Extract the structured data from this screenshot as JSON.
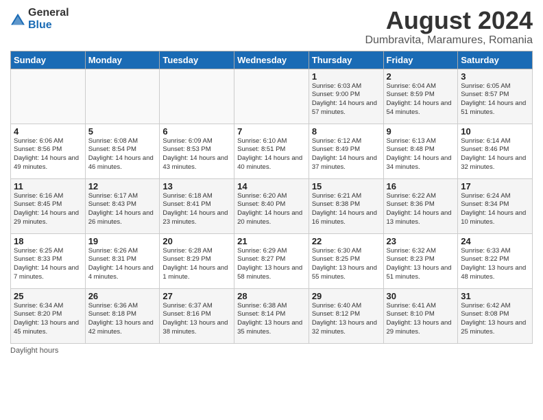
{
  "logo": {
    "general": "General",
    "blue": "Blue"
  },
  "title": "August 2024",
  "subtitle": "Dumbravita, Maramures, Romania",
  "weekdays": [
    "Sunday",
    "Monday",
    "Tuesday",
    "Wednesday",
    "Thursday",
    "Friday",
    "Saturday"
  ],
  "footer": "Daylight hours",
  "weeks": [
    [
      {
        "day": "",
        "info": ""
      },
      {
        "day": "",
        "info": ""
      },
      {
        "day": "",
        "info": ""
      },
      {
        "day": "",
        "info": ""
      },
      {
        "day": "1",
        "info": "Sunrise: 6:03 AM\nSunset: 9:00 PM\nDaylight: 14 hours and 57 minutes."
      },
      {
        "day": "2",
        "info": "Sunrise: 6:04 AM\nSunset: 8:59 PM\nDaylight: 14 hours and 54 minutes."
      },
      {
        "day": "3",
        "info": "Sunrise: 6:05 AM\nSunset: 8:57 PM\nDaylight: 14 hours and 51 minutes."
      }
    ],
    [
      {
        "day": "4",
        "info": "Sunrise: 6:06 AM\nSunset: 8:56 PM\nDaylight: 14 hours and 49 minutes."
      },
      {
        "day": "5",
        "info": "Sunrise: 6:08 AM\nSunset: 8:54 PM\nDaylight: 14 hours and 46 minutes."
      },
      {
        "day": "6",
        "info": "Sunrise: 6:09 AM\nSunset: 8:53 PM\nDaylight: 14 hours and 43 minutes."
      },
      {
        "day": "7",
        "info": "Sunrise: 6:10 AM\nSunset: 8:51 PM\nDaylight: 14 hours and 40 minutes."
      },
      {
        "day": "8",
        "info": "Sunrise: 6:12 AM\nSunset: 8:49 PM\nDaylight: 14 hours and 37 minutes."
      },
      {
        "day": "9",
        "info": "Sunrise: 6:13 AM\nSunset: 8:48 PM\nDaylight: 14 hours and 34 minutes."
      },
      {
        "day": "10",
        "info": "Sunrise: 6:14 AM\nSunset: 8:46 PM\nDaylight: 14 hours and 32 minutes."
      }
    ],
    [
      {
        "day": "11",
        "info": "Sunrise: 6:16 AM\nSunset: 8:45 PM\nDaylight: 14 hours and 29 minutes."
      },
      {
        "day": "12",
        "info": "Sunrise: 6:17 AM\nSunset: 8:43 PM\nDaylight: 14 hours and 26 minutes."
      },
      {
        "day": "13",
        "info": "Sunrise: 6:18 AM\nSunset: 8:41 PM\nDaylight: 14 hours and 23 minutes."
      },
      {
        "day": "14",
        "info": "Sunrise: 6:20 AM\nSunset: 8:40 PM\nDaylight: 14 hours and 20 minutes."
      },
      {
        "day": "15",
        "info": "Sunrise: 6:21 AM\nSunset: 8:38 PM\nDaylight: 14 hours and 16 minutes."
      },
      {
        "day": "16",
        "info": "Sunrise: 6:22 AM\nSunset: 8:36 PM\nDaylight: 14 hours and 13 minutes."
      },
      {
        "day": "17",
        "info": "Sunrise: 6:24 AM\nSunset: 8:34 PM\nDaylight: 14 hours and 10 minutes."
      }
    ],
    [
      {
        "day": "18",
        "info": "Sunrise: 6:25 AM\nSunset: 8:33 PM\nDaylight: 14 hours and 7 minutes."
      },
      {
        "day": "19",
        "info": "Sunrise: 6:26 AM\nSunset: 8:31 PM\nDaylight: 14 hours and 4 minutes."
      },
      {
        "day": "20",
        "info": "Sunrise: 6:28 AM\nSunset: 8:29 PM\nDaylight: 14 hours and 1 minute."
      },
      {
        "day": "21",
        "info": "Sunrise: 6:29 AM\nSunset: 8:27 PM\nDaylight: 13 hours and 58 minutes."
      },
      {
        "day": "22",
        "info": "Sunrise: 6:30 AM\nSunset: 8:25 PM\nDaylight: 13 hours and 55 minutes."
      },
      {
        "day": "23",
        "info": "Sunrise: 6:32 AM\nSunset: 8:23 PM\nDaylight: 13 hours and 51 minutes."
      },
      {
        "day": "24",
        "info": "Sunrise: 6:33 AM\nSunset: 8:22 PM\nDaylight: 13 hours and 48 minutes."
      }
    ],
    [
      {
        "day": "25",
        "info": "Sunrise: 6:34 AM\nSunset: 8:20 PM\nDaylight: 13 hours and 45 minutes."
      },
      {
        "day": "26",
        "info": "Sunrise: 6:36 AM\nSunset: 8:18 PM\nDaylight: 13 hours and 42 minutes."
      },
      {
        "day": "27",
        "info": "Sunrise: 6:37 AM\nSunset: 8:16 PM\nDaylight: 13 hours and 38 minutes."
      },
      {
        "day": "28",
        "info": "Sunrise: 6:38 AM\nSunset: 8:14 PM\nDaylight: 13 hours and 35 minutes."
      },
      {
        "day": "29",
        "info": "Sunrise: 6:40 AM\nSunset: 8:12 PM\nDaylight: 13 hours and 32 minutes."
      },
      {
        "day": "30",
        "info": "Sunrise: 6:41 AM\nSunset: 8:10 PM\nDaylight: 13 hours and 29 minutes."
      },
      {
        "day": "31",
        "info": "Sunrise: 6:42 AM\nSunset: 8:08 PM\nDaylight: 13 hours and 25 minutes."
      }
    ]
  ]
}
